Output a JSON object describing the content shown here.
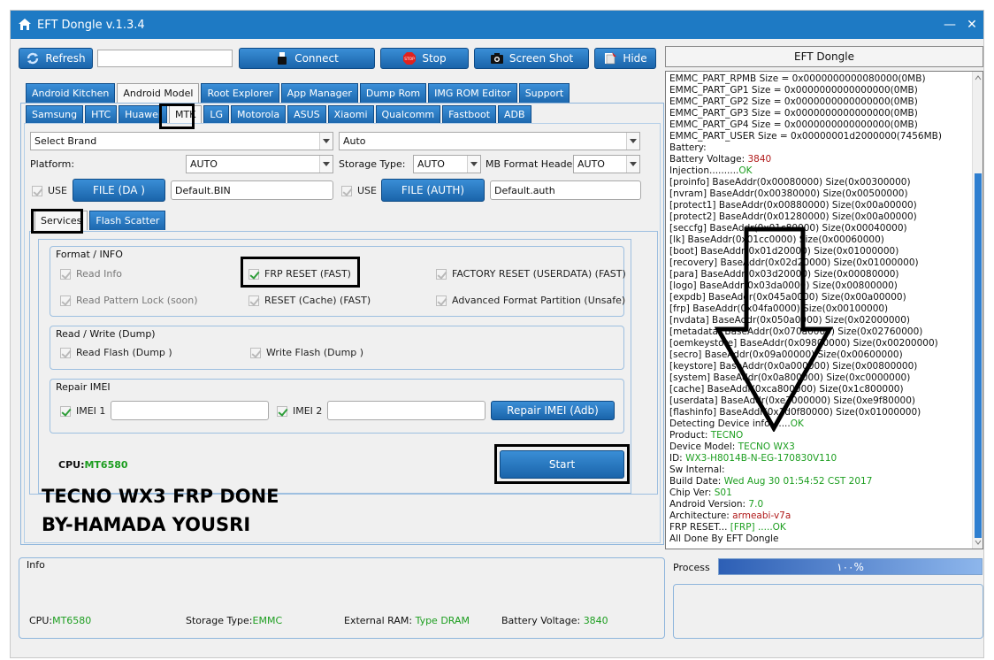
{
  "window": {
    "title": "EFT Dongle  v.1.3.4",
    "minimize": "—",
    "close": "✕"
  },
  "toolbar": {
    "refresh": "Refresh",
    "port_value": "",
    "connect": "Connect",
    "stop": "Stop",
    "stop_badge": "STOP",
    "screenshot": "Screen Shot",
    "hide": "Hide"
  },
  "main_tabs": [
    "Android Kitchen",
    "Android Model",
    "Root Explorer",
    "App Manager",
    "Dump Rom",
    "IMG ROM Editor",
    "Support"
  ],
  "brand_tabs": [
    "Samsung",
    "HTC",
    "Huawei",
    "MTK",
    "LG",
    "Motorola",
    "ASUS",
    "Xiaomi",
    "Qualcomm",
    "Fastboot",
    "ADB"
  ],
  "selectors": {
    "brand": "Select Brand",
    "model": "Auto",
    "platform_label": "Platform:",
    "platform": "AUTO",
    "storage_label": "Storage Type:",
    "storage": "AUTO",
    "mb_label": "MB Format Header",
    "mb": "AUTO"
  },
  "files": {
    "use1": "USE",
    "da_button": "FILE (DA )",
    "da_value": "Default.BIN",
    "use2": "USE",
    "auth_button": "FILE (AUTH)",
    "auth_value": "Default.auth"
  },
  "sub_tabs": [
    "Services",
    "Flash Scatter"
  ],
  "format_group": {
    "title": "Format / INFO",
    "read_info": "Read Info",
    "frp_reset": "FRP RESET (FAST)",
    "factory_reset": "FACTORY RESET (USERDATA) (FAST)",
    "read_pattern": "Read Pattern Lock (soon)",
    "reset_cache": "RESET (Cache) (FAST)",
    "adv_format": "Advanced Format Partition (Unsafe)"
  },
  "rw_group": {
    "title": "Read / Write (Dump)",
    "read_flash": "Read Flash (Dump )",
    "write_flash": "Write Flash (Dump )"
  },
  "imei_group": {
    "title": "Repair IMEI",
    "imei1": "IMEI 1",
    "imei1_value": "",
    "imei2": "IMEI 2",
    "imei2_value": "",
    "repair_button": "Repair IMEI (Adb)"
  },
  "cpu": {
    "label": "CPU:",
    "value": "MT6580"
  },
  "start_button": "Start",
  "banner": {
    "line1": "TECNO WX3 FRP DONE",
    "line2": "BY-HAMADA YOUSRI"
  },
  "right_header": "EFT Dongle",
  "log": [
    {
      "t": "EMMC_PART_RPMB Size = 0x0000000000080000(0MB)"
    },
    {
      "t": "EMMC_PART_GP1 Size = 0x0000000000000000(0MB)"
    },
    {
      "t": "EMMC_PART_GP2 Size = 0x0000000000000000(0MB)"
    },
    {
      "t": "EMMC_PART_GP3 Size = 0x0000000000000000(0MB)"
    },
    {
      "t": "EMMC_PART_GP4 Size = 0x0000000000000000(0MB)"
    },
    {
      "t": "EMMC_PART_USER Size = 0x00000001d2000000(7456MB)"
    },
    {
      "t": "Battery:"
    },
    {
      "t": "Battery Voltage: ",
      "v": "3840",
      "c": "red"
    },
    {
      "t": "Injection..........",
      "v": "OK",
      "c": "ok"
    },
    {
      "t": "[proinfo] BaseAddr(0x00080000) Size(0x00300000)"
    },
    {
      "t": "[nvram] BaseAddr(0x00380000) Size(0x00500000)"
    },
    {
      "t": "[protect1] BaseAddr(0x00880000) Size(0x00a00000)"
    },
    {
      "t": "[protect2] BaseAddr(0x01280000) Size(0x00a00000)"
    },
    {
      "t": "[seccfg] BaseAddr(0x01c80000) Size(0x00040000)"
    },
    {
      "t": "[lk] BaseAddr(0x01cc0000) Size(0x00060000)"
    },
    {
      "t": "[boot] BaseAddr(0x01d20000) Size(0x01000000)"
    },
    {
      "t": "[recovery] BaseAddr(0x02d20000) Size(0x01000000)"
    },
    {
      "t": "[para] BaseAddr(0x03d20000) Size(0x00080000)"
    },
    {
      "t": "[logo] BaseAddr(0x03da0000) Size(0x00800000)"
    },
    {
      "t": "[expdb] BaseAddr(0x045a0000) Size(0x00a00000)"
    },
    {
      "t": "[frp] BaseAddr(0x04fa0000) Size(0x00100000)"
    },
    {
      "t": "[nvdata] BaseAddr(0x050a0000) Size(0x02000000)"
    },
    {
      "t": "[metadata] BaseAddr(0x070a0000) Size(0x02760000)"
    },
    {
      "t": "[oemkeystore] BaseAddr(0x09800000) Size(0x00200000)"
    },
    {
      "t": "[secro] BaseAddr(0x09a00000) Size(0x00600000)"
    },
    {
      "t": "[keystore] BaseAddr(0x0a000000) Size(0x00800000)"
    },
    {
      "t": "[system] BaseAddr(0x0a800000) Size(0xc0000000)"
    },
    {
      "t": "[cache] BaseAddr(0xca800000) Size(0x1c800000)"
    },
    {
      "t": "[userdata] BaseAddr(0xe7000000) Size(0xe9f80000)"
    },
    {
      "t": "[flashinfo] BaseAddr(0x1d0f80000) Size(0x01000000)"
    },
    {
      "t": "Detecting Device info.......",
      "v": "OK",
      "c": "ok"
    },
    {
      "t": "Product: ",
      "v": "TECNO",
      "c": "ok"
    },
    {
      "t": "Device Model: ",
      "v": "TECNO WX3",
      "c": "ok"
    },
    {
      "t": "ID: ",
      "v": "WX3-H8014B-N-EG-170830V110",
      "c": "ok"
    },
    {
      "t": "Sw Internal:"
    },
    {
      "t": "Build Date: ",
      "v": "Wed Aug 30 01:54:52 CST 2017",
      "c": "ok"
    },
    {
      "t": "Chip Ver: ",
      "v": "S01",
      "c": "ok"
    },
    {
      "t": "Android Version: ",
      "v": "7.0",
      "c": "ok"
    },
    {
      "t": "Architecture: ",
      "v": "armeabi-v7a",
      "c": "red"
    },
    {
      "t": "FRP RESET... ",
      "v": "[FRP] .....OK",
      "c": "ok"
    },
    {
      "t": "All Done By EFT Dongle"
    }
  ],
  "process": {
    "label": "Process",
    "value": "١٠٠%",
    "percent": 100
  },
  "info": {
    "title": "Info",
    "cpu_label": "CPU:",
    "cpu": "MT6580",
    "storage_label": "Storage Type:",
    "storage": "EMMC",
    "ram_label": "External RAM: ",
    "ram": "Type DRAM",
    "battery_label": "Battery Voltage: ",
    "battery": "3840"
  },
  "colors": {
    "accent": "#1e7ac4",
    "ok": "#1d9e20",
    "red": "#b01818"
  }
}
